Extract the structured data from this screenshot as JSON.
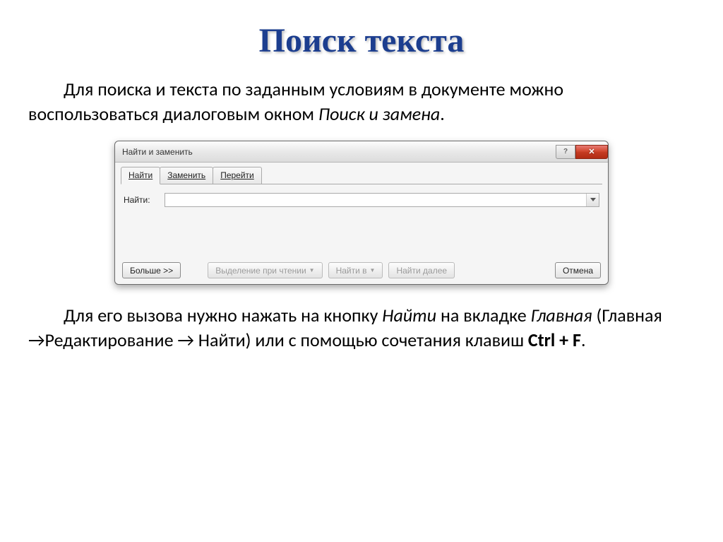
{
  "title": "Поиск текста",
  "intro": {
    "text_before": "Для поиска и текста по заданным условиям в документе можно воспользоваться диалоговым окном ",
    "italic_part": "Поиск и замена",
    "text_after": "."
  },
  "dialog": {
    "title": "Найти и заменить",
    "help_symbol": "?",
    "close_symbol": "✕",
    "tabs": {
      "find": "Найти",
      "replace": "Заменить",
      "goto": "Перейти"
    },
    "find_label": "Найти:",
    "find_value": "",
    "buttons": {
      "more": "Больше >>",
      "highlight": "Выделение при чтении",
      "find_in": "Найти в",
      "find_next": "Найти далее",
      "cancel": "Отмена"
    }
  },
  "outro": {
    "p1_a": "Для его вызова нужно нажать на кнопку ",
    "p1_find": "Найти",
    "p1_b": " на вкладке ",
    "p1_main": "Главная",
    "p1_c": " (Главная →Редактирование → Найти) или с помощью сочетания клавиш ",
    "p1_ctrl": "Ctrl + F",
    "p1_d": "."
  }
}
